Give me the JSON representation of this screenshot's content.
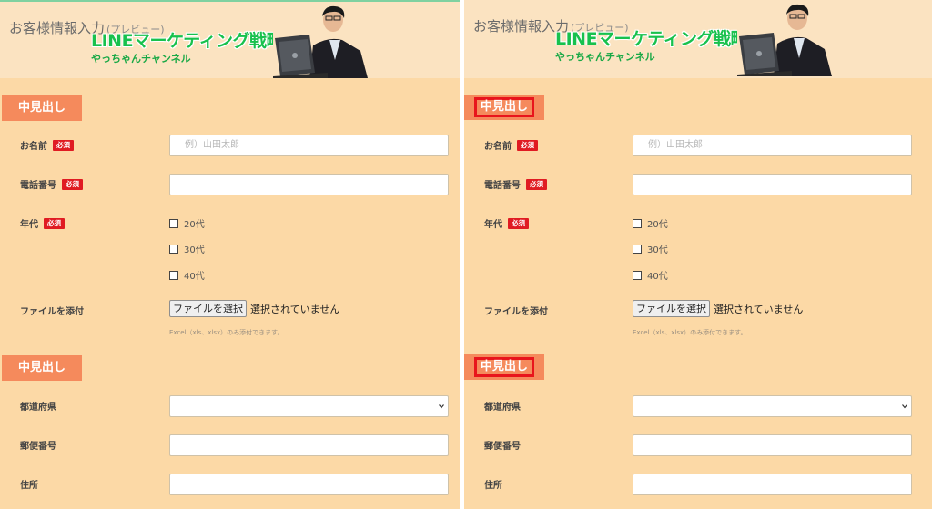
{
  "banner": {
    "title": "お客様情報入力",
    "preview": "(プレビュー)",
    "headline": "LINEマーケティング戦略",
    "channel": "やっちゃんチャンネル"
  },
  "sections": {
    "heading1": "中見出し",
    "heading2": "中見出し"
  },
  "fields": {
    "name_label": "お名前",
    "name_placeholder": "例）山田太郎",
    "phone_label": "電話番号",
    "age_label": "年代",
    "age_options": [
      "20代",
      "30代",
      "40代"
    ],
    "file_label": "ファイルを添付",
    "file_button": "ファイルを選択",
    "file_status": "選択されていません",
    "file_hint": "Excel（xls、xlsx）のみ添付できます。",
    "prefecture_label": "都道府県",
    "prefecture_value": "",
    "postal_label": "郵便番号",
    "address_label": "住所",
    "required_badge": "必須"
  },
  "colors": {
    "page_bg": "#fcd9a6",
    "banner_bg": "#fbe3c1",
    "heading_badge": "#f58a5c",
    "required_badge": "#e01b22",
    "highlight_outline": "#e8141c",
    "headline_green": "#18c14d"
  }
}
